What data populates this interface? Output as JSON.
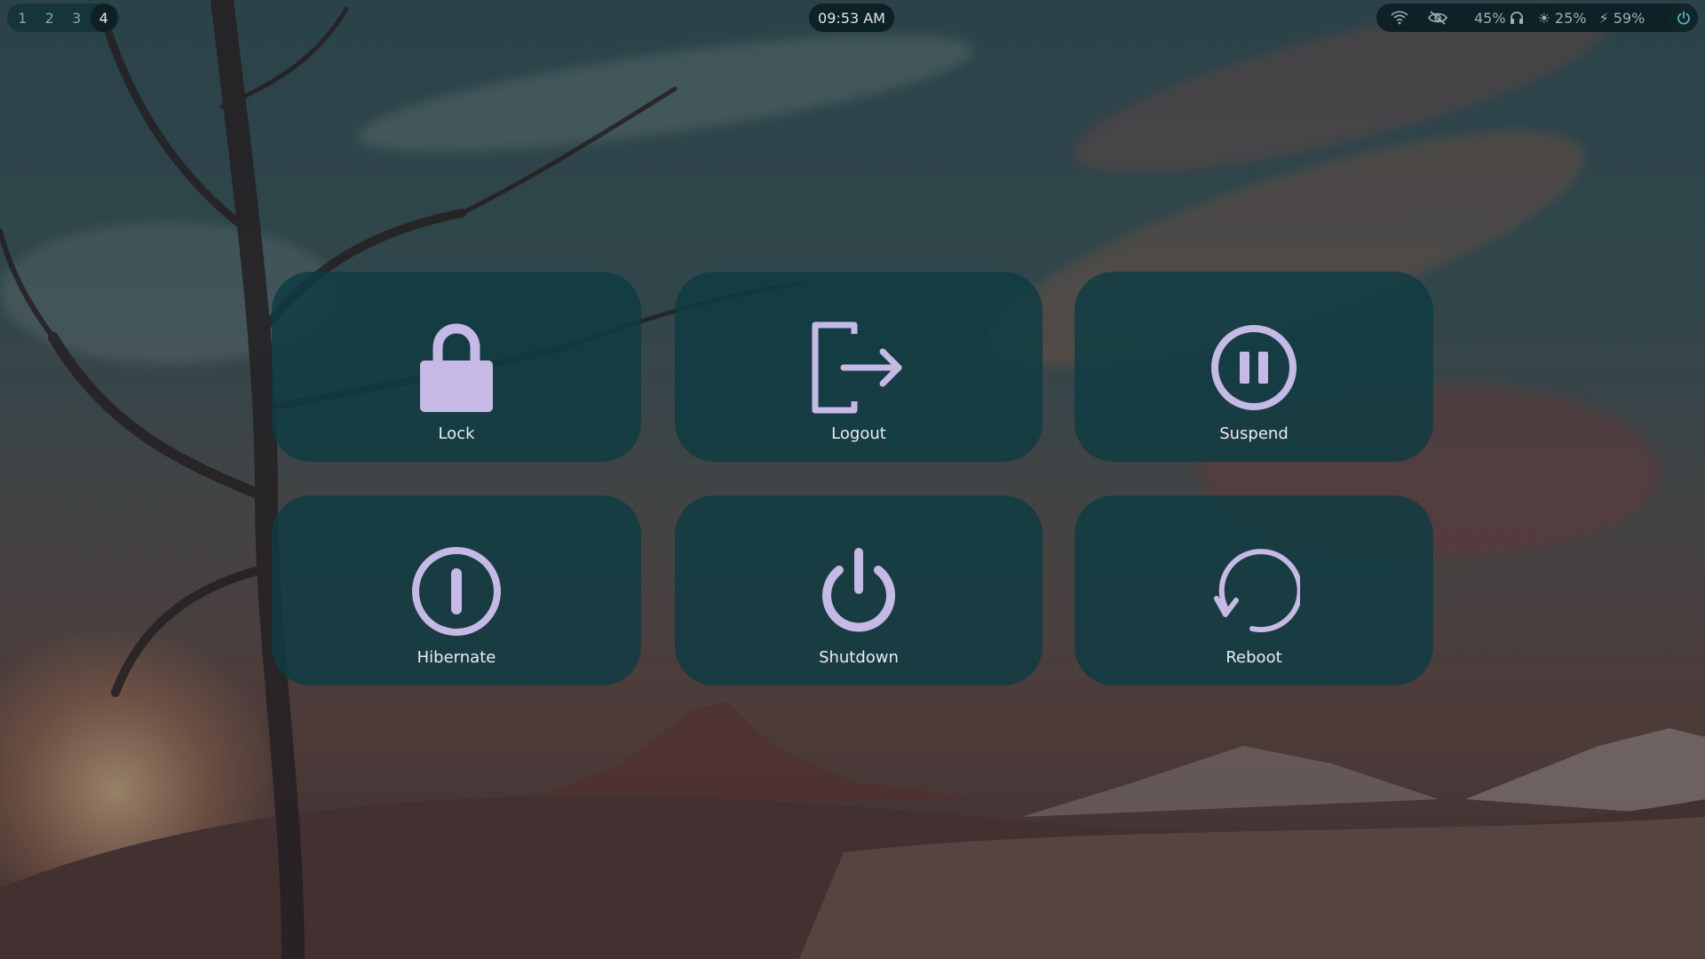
{
  "topbar": {
    "workspaces": [
      "1",
      "2",
      "3",
      "4"
    ],
    "active_workspace": "4",
    "clock": "09:53 AM",
    "tray": {
      "wifi_icon": "wifi-icon",
      "privacy_icon": "eye-off-icon",
      "volume": "45%",
      "headphones_icon": "headphones-icon",
      "brightness_icon": "sun-icon",
      "brightness": "25%",
      "battery_icon": "lightning-icon",
      "battery": "59%",
      "power_icon": "power-icon"
    }
  },
  "power_menu": {
    "actions": [
      {
        "label": "Lock",
        "icon": "lock-icon"
      },
      {
        "label": "Logout",
        "icon": "logout-icon"
      },
      {
        "label": "Suspend",
        "icon": "pause-circle-icon"
      },
      {
        "label": "Hibernate",
        "icon": "hibernate-icon"
      },
      {
        "label": "Shutdown",
        "icon": "power-icon"
      },
      {
        "label": "Reboot",
        "icon": "reboot-icon"
      }
    ]
  },
  "colors": {
    "icon": "#c7b9e6",
    "card": "#0e3c42",
    "label": "#ecebf2"
  }
}
